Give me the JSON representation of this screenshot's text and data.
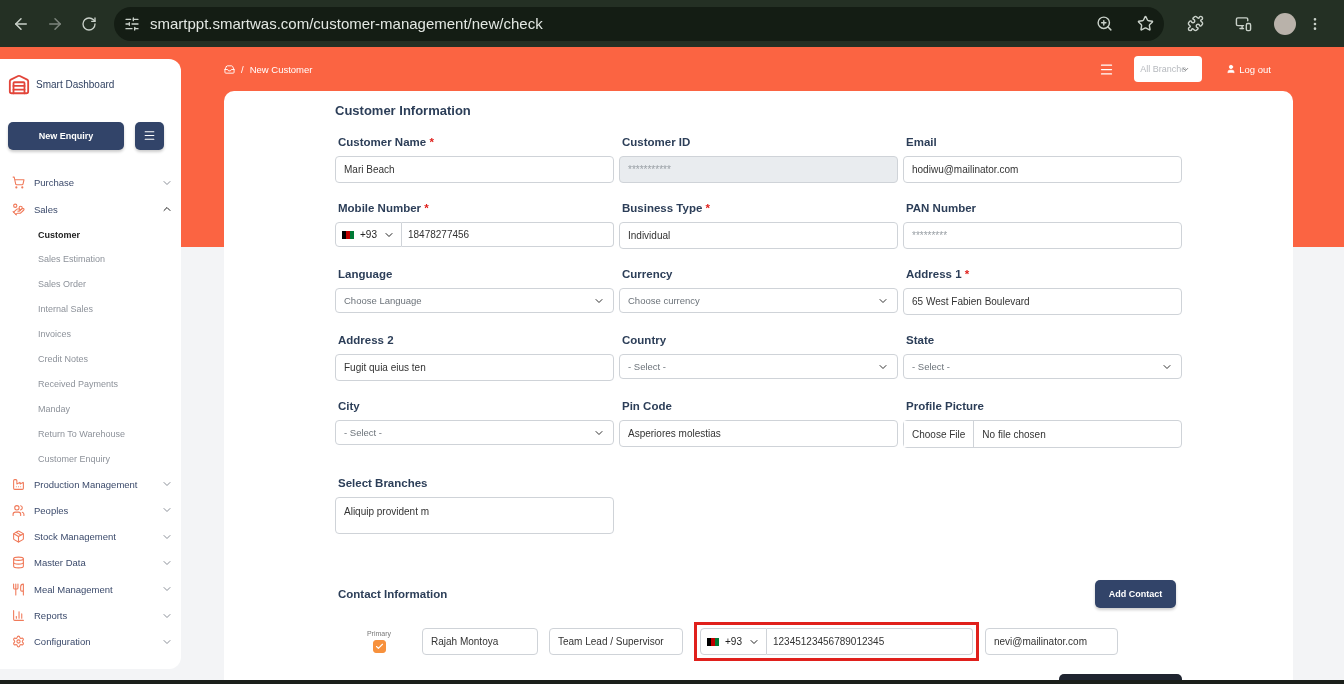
{
  "browser": {
    "url": "smartppt.smartwas.com/customer-management/new/check"
  },
  "sidebar": {
    "brand": "Smart Dashboard",
    "new_button": "New Enquiry",
    "items": [
      {
        "label": "Purchase",
        "expanded": false
      },
      {
        "label": "Sales",
        "expanded": true,
        "children": [
          {
            "label": "Customer",
            "selected": true
          },
          {
            "label": "Sales Estimation",
            "selected": false
          },
          {
            "label": "Sales Order",
            "selected": false
          },
          {
            "label": "Internal Sales",
            "selected": false
          },
          {
            "label": "Invoices",
            "selected": false
          },
          {
            "label": "Credit Notes",
            "selected": false
          },
          {
            "label": "Received Payments",
            "selected": false
          },
          {
            "label": "Manday",
            "selected": false
          },
          {
            "label": "Return To Warehouse",
            "selected": false
          },
          {
            "label": "Customer Enquiry",
            "selected": false
          }
        ]
      },
      {
        "label": "Production Management",
        "expanded": false
      },
      {
        "label": "Peoples",
        "expanded": false
      },
      {
        "label": "Stock Management",
        "expanded": false
      },
      {
        "label": "Master Data",
        "expanded": false
      },
      {
        "label": "Meal Management",
        "expanded": false
      },
      {
        "label": "Reports",
        "expanded": false
      },
      {
        "label": "Configuration",
        "expanded": false
      }
    ]
  },
  "breadcrumb": {
    "separator": "/",
    "current": "New Customer"
  },
  "topbar": {
    "branch_select": "All Branche",
    "logout": "Log out"
  },
  "form": {
    "title": "Customer Information",
    "required_mark": "*",
    "rows": [
      [
        {
          "label": "Customer Name",
          "required": true,
          "kind": "text",
          "value": "Mari Beach"
        },
        {
          "label": "Customer ID",
          "required": false,
          "kind": "disabled",
          "placeholder": "***********"
        },
        {
          "label": "Email",
          "required": false,
          "kind": "text",
          "value": "hodiwu@mailinator.com"
        }
      ],
      [
        {
          "label": "Mobile Number",
          "required": true,
          "kind": "phone",
          "country_code": "+93",
          "value": "18478277456"
        },
        {
          "label": "Business Type",
          "required": true,
          "kind": "text",
          "value": "Individual"
        },
        {
          "label": "PAN Number",
          "required": false,
          "kind": "text",
          "placeholder": "*********"
        }
      ],
      [
        {
          "label": "Language",
          "required": false,
          "kind": "select",
          "value": "Choose Language"
        },
        {
          "label": "Currency",
          "required": false,
          "kind": "select",
          "value": "Choose currency"
        },
        {
          "label": "Address 1",
          "required": true,
          "kind": "text",
          "value": "65 West Fabien Boulevard"
        }
      ],
      [
        {
          "label": "Address 2",
          "required": false,
          "kind": "text",
          "value": "Fugit quia eius ten"
        },
        {
          "label": "Country",
          "required": false,
          "kind": "select",
          "value": "- Select -"
        },
        {
          "label": "State",
          "required": false,
          "kind": "select",
          "value": "- Select -"
        }
      ],
      [
        {
          "label": "City",
          "required": false,
          "kind": "select",
          "value": "- Select -"
        },
        {
          "label": "Pin Code",
          "required": false,
          "kind": "text",
          "value": "Asperiores molestias"
        },
        {
          "label": "Profile Picture",
          "required": false,
          "kind": "file",
          "button": "Choose File",
          "value": "No file chosen"
        }
      ],
      [
        {
          "label": "Select Branches",
          "required": false,
          "kind": "textarea",
          "value": "Aliquip provident m"
        }
      ]
    ]
  },
  "contact": {
    "title": "Contact Information",
    "add_button": "Add Contact",
    "rows": [
      {
        "primary_label": "Primary",
        "primary": true,
        "name": "Rajah Montoya",
        "role": "Team Lead / Supervisor",
        "country_code": "+93",
        "phone": "12345123456789012345",
        "email": "nevi@mailinator.com",
        "highlighted": true
      }
    ]
  }
}
